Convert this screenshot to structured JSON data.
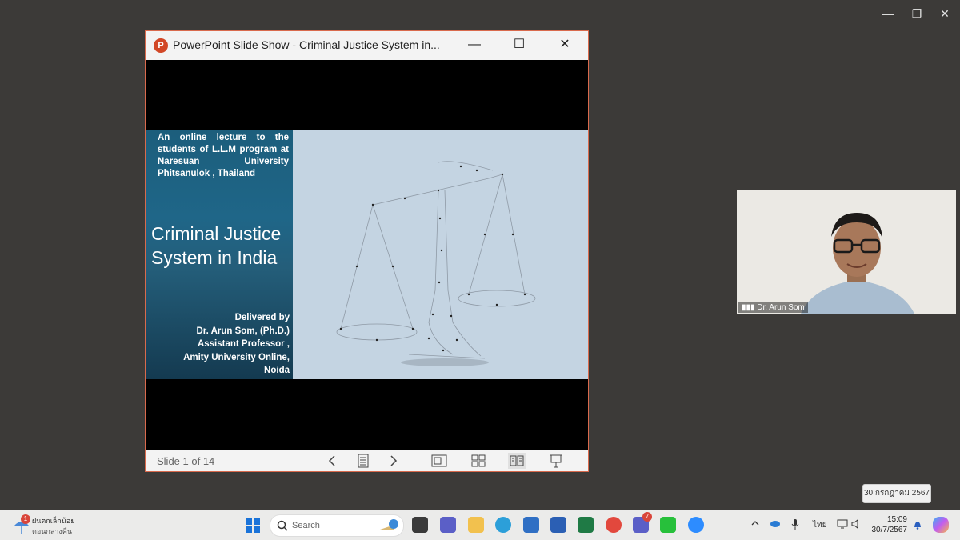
{
  "desktop_controls": {
    "minimize": "—",
    "restore": "❐",
    "close": "✕"
  },
  "ppt_window": {
    "title": "PowerPoint Slide Show  -  Criminal Justice System in...",
    "app_badge": "P",
    "minimize": "—",
    "maximize": "☐",
    "close": "✕",
    "slide": {
      "intro": "An online lecture to the students of L.L.M program at Naresuan University Phitsanulok , Thailand",
      "title": "Criminal Justice System in India",
      "delivered_lines": [
        "Delivered by",
        "Dr. Arun Som, (Ph.D.)",
        "Assistant Professor ,",
        "Amity University Online,",
        "Noida"
      ]
    },
    "status": "Slide 1 of 14"
  },
  "video": {
    "participant": "Dr. Arun Som"
  },
  "tooltip": "30 กรกฎาคม 2567",
  "taskbar": {
    "weather_badge": "1",
    "weather_line1": "ฝนตกเล็กน้อย",
    "weather_line2": "ตอนกลางคืน",
    "search_placeholder": "Search",
    "teams_badge": "7",
    "ime": "ไทย",
    "time": "15:09",
    "date": "30/7/2567"
  },
  "colors": {
    "ppt_border": "#d96a4d",
    "slide_left": "#1f6688",
    "slide_right": "#c4d4e2",
    "taskbar": "#ebebea"
  }
}
